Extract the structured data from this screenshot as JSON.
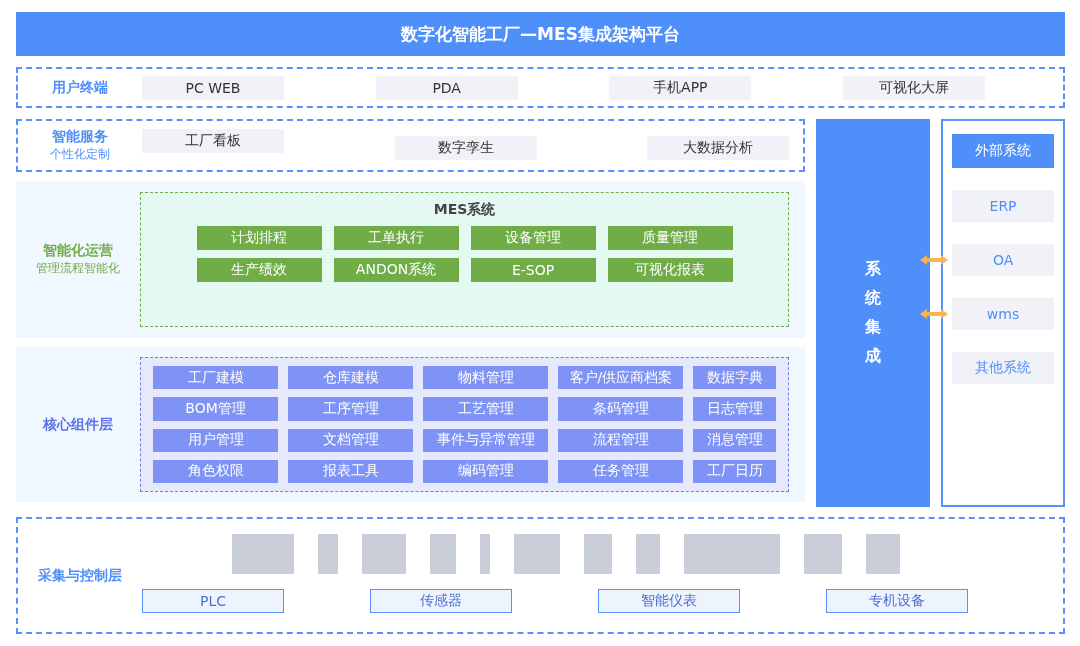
{
  "title": "数字化智能工厂—MES集成架构平台",
  "user_terminal": {
    "label": "用户终端",
    "items": [
      "PC WEB",
      "PDA",
      "手机APP",
      "可视化大屏"
    ]
  },
  "smart_services": {
    "label": "智能服务",
    "sublabel": "个性化定制",
    "items": [
      "工厂看板",
      "数字孪生",
      "大数据分析"
    ]
  },
  "smart_operations": {
    "label": "智能化运营",
    "sublabel": "管理流程智能化",
    "mes_title": "MES系统",
    "items": [
      "计划排程",
      "工单执行",
      "设备管理",
      "质量管理",
      "生产绩效",
      "ANDON系统",
      "E-SOP",
      "可视化报表"
    ]
  },
  "core_components": {
    "label": "核心组件层",
    "items": [
      "工厂建模",
      "仓库建模",
      "物料管理",
      "客户/供应商档案",
      "数据字典",
      "BOM管理",
      "工序管理",
      "工艺管理",
      "条码管理",
      "日志管理",
      "用户管理",
      "文档管理",
      "事件与异常管理",
      "流程管理",
      "消息管理",
      "角色权限",
      "报表工具",
      "编码管理",
      "任务管理",
      "工厂日历"
    ]
  },
  "system_integration": {
    "label": "系统集成"
  },
  "external_systems": {
    "title": "外部系统",
    "items": [
      {
        "label": "ERP",
        "linked": false
      },
      {
        "label": "OA",
        "linked": true
      },
      {
        "label": "wms",
        "linked": true
      },
      {
        "label": "其他系统",
        "linked": false
      }
    ]
  },
  "acquisition_control": {
    "label": "采集与控制层",
    "categories": [
      "PLC",
      "传感器",
      "智能仪表",
      "专机设备"
    ]
  }
}
